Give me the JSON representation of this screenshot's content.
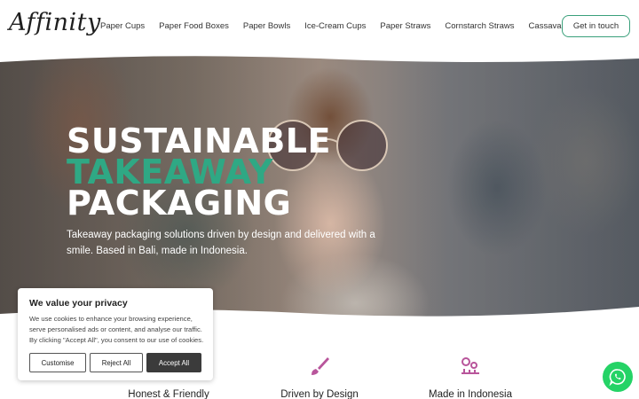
{
  "header": {
    "logo": "Affinity",
    "nav": [
      "Paper Cups",
      "Paper Food Boxes",
      "Paper Bowls",
      "Ice-Cream Cups",
      "Paper Straws",
      "Cornstarch Straws",
      "Cassava Bags"
    ],
    "cta": "Get in touch"
  },
  "hero": {
    "title_line1": "SUSTAINABLE",
    "title_line2": "TAKEAWAY",
    "title_line3": "PACKAGING",
    "subtitle": "Takeaway packaging solutions driven by design and delivered with a smile. Based in Bali, made in Indonesia."
  },
  "features": [
    {
      "label": "Honest & Friendly",
      "icon": "handshake-icon"
    },
    {
      "label": "Driven by Design",
      "icon": "paintbrush-icon"
    },
    {
      "label": "Made in Indonesia",
      "icon": "gears-icon"
    }
  ],
  "cookie": {
    "title": "We value your privacy",
    "text": "We use cookies to enhance your browsing experience, serve personalised ads or content, and analyse our traffic. By clicking \"Accept All\", you consent to our use of cookies.",
    "customise": "Customise",
    "reject": "Reject All",
    "accept": "Accept All"
  },
  "colors": {
    "accent": "#2fa884",
    "icon_purple": "#b8559b",
    "whatsapp": "#25d366"
  }
}
